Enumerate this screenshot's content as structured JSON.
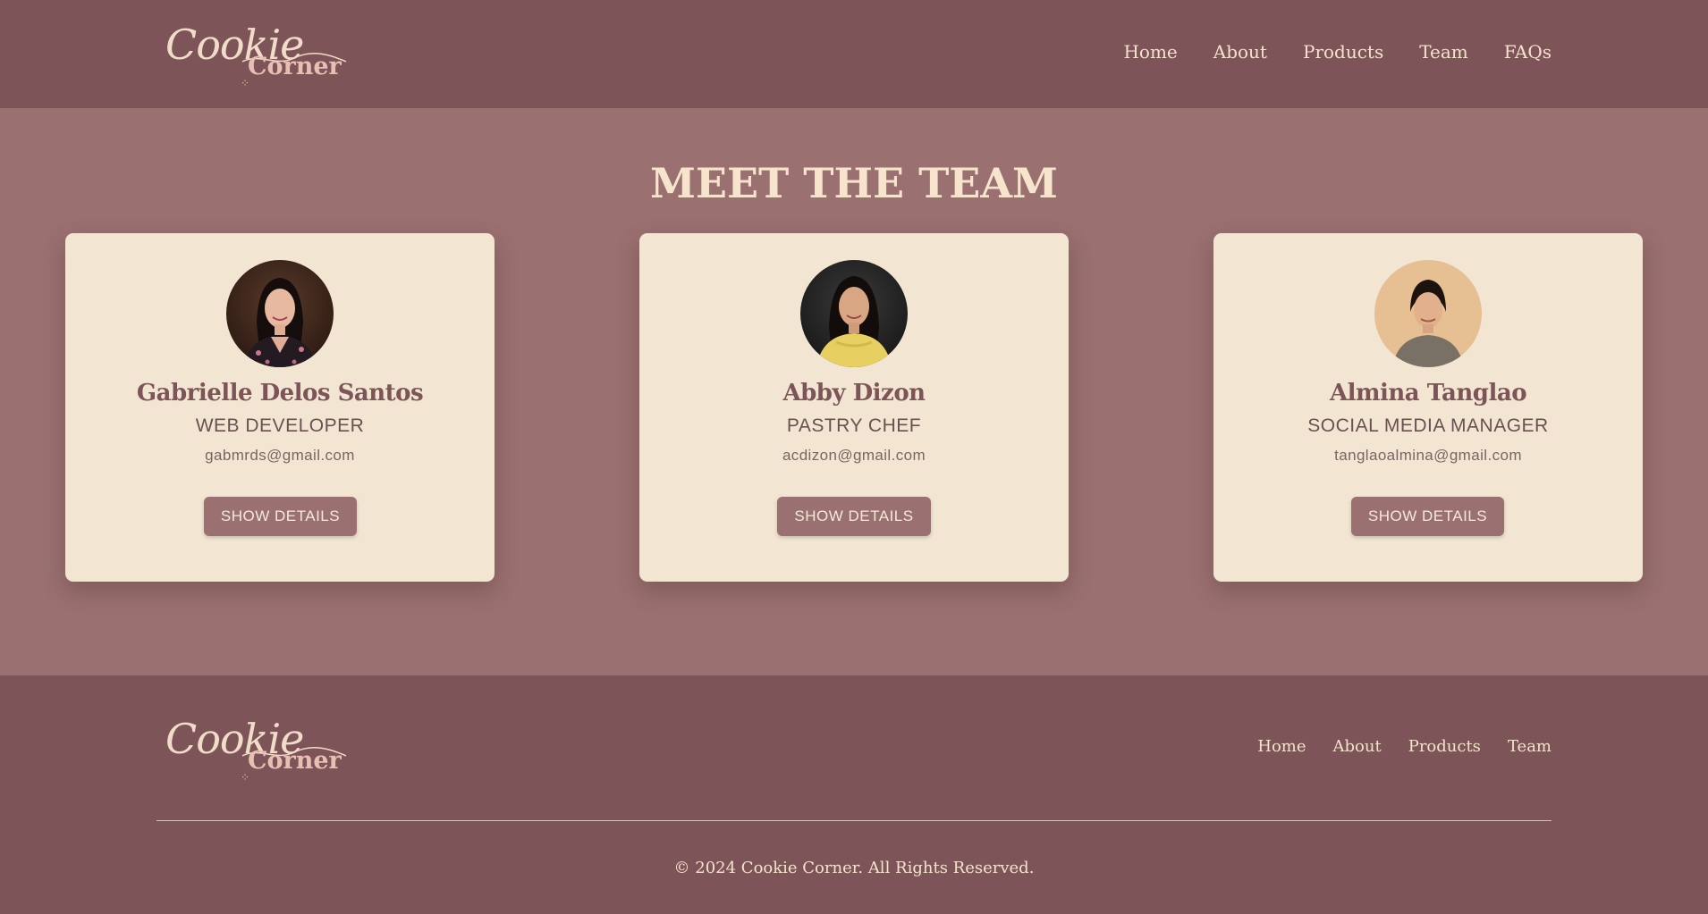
{
  "brand": {
    "logo_script": "Cookie",
    "logo_bold": "Corner",
    "colors": {
      "header_bg": "#7d5558",
      "page_bg": "#9a7070",
      "card_bg": "#f2e6d3",
      "accent": "#9a7070",
      "text_light": "#f4e2cc"
    }
  },
  "nav": {
    "items": [
      {
        "label": "Home"
      },
      {
        "label": "About"
      },
      {
        "label": "Products"
      },
      {
        "label": "Team"
      },
      {
        "label": "FAQs"
      }
    ]
  },
  "main": {
    "title": "MEET THE TEAM",
    "members": [
      {
        "name": "Gabrielle Delos Santos",
        "role": "WEB DEVELOPER",
        "email": "gabmrds@gmail.com",
        "button": "SHOW DETAILS",
        "photo": "woman-dark-background-photo"
      },
      {
        "name": "Abby Dizon",
        "role": "PASTRY CHEF",
        "email": "acdizon@gmail.com",
        "button": "SHOW DETAILS",
        "photo": "woman-yellow-top-photo"
      },
      {
        "name": "Almina Tanglao",
        "role": "SOCIAL MEDIA MANAGER",
        "email": "tanglaoalmina@gmail.com",
        "button": "SHOW DETAILS",
        "photo": "woman-peach-background-photo"
      }
    ]
  },
  "footer": {
    "nav": [
      {
        "label": "Home"
      },
      {
        "label": "About"
      },
      {
        "label": "Products"
      },
      {
        "label": "Team"
      }
    ],
    "copyright": "© 2024 Cookie Corner. All Rights Reserved."
  }
}
